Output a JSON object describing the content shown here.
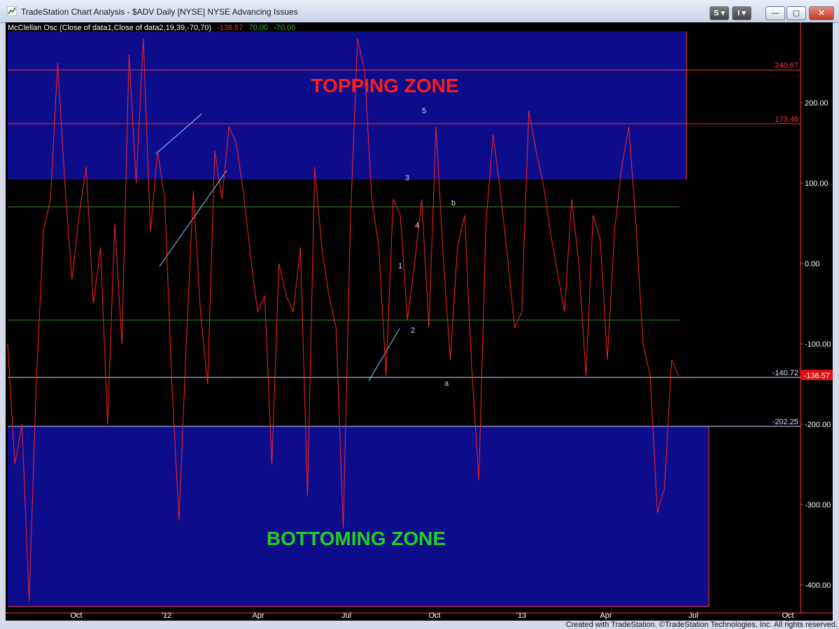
{
  "window": {
    "title": "TradeStation Chart Analysis - $ADV Daily [NYSE] NYSE Advancing Issues",
    "buttons": {
      "s": "S",
      "i": "I",
      "minimize": "—",
      "restore": "▢",
      "close": "✕"
    }
  },
  "indicator": {
    "label": "McClellan Osc (Close of data1,Close of data2,19,39,-70,70)",
    "value": "-136.57",
    "upper": "70.00",
    "lower": "-70.00"
  },
  "zones": {
    "topping_label": "TOPPING ZONE",
    "bottoming_label": "BOTTOMING ZONE"
  },
  "levels": {
    "l1": "240.67",
    "l2": "173.46",
    "l3": "-140.72",
    "l4": "-202.25",
    "current_badge": "-136.57"
  },
  "wave_labels": [
    "5",
    "3",
    "b",
    "4",
    "1",
    "2",
    "a"
  ],
  "footer": "Created with TradeStation. ©TradeStation Technologies, Inc. All rights reserved.",
  "colors": {
    "background": "#000000",
    "zone": "#0d0d8c",
    "oscillator": "#ff2222",
    "topping_text": "#ff1a1a",
    "bottoming_text": "#22d022",
    "guide_green": "#2f8f2f",
    "trend_lines": "#7fd4ff"
  },
  "chart_data": {
    "type": "line",
    "title": "",
    "xlabel": "",
    "ylabel": "",
    "ylim": [
      -420,
      290
    ],
    "y_ticks": [
      "200.00",
      "100.00",
      "0.00",
      "-100.00",
      "-200.00",
      "-300.00",
      "-400.00"
    ],
    "x_ticks": [
      "Oct",
      "'12",
      "Apr",
      "Jul",
      "Oct",
      "'13",
      "Apr",
      "Jul",
      "Oct"
    ],
    "reference_lines": [
      240.67,
      173.46,
      70,
      -70,
      -140.72,
      -202.25
    ],
    "zones": [
      {
        "name": "TOPPING ZONE",
        "from": 104,
        "to": 288
      },
      {
        "name": "BOTTOMING ZONE",
        "from": -202.25,
        "to": -425
      }
    ],
    "series": [
      {
        "values": [
          -100,
          -250,
          -200,
          -420,
          -150,
          40,
          80,
          250,
          100,
          -20,
          60,
          120,
          -50,
          20,
          -200,
          50,
          -100,
          260,
          100,
          280,
          40,
          140,
          80,
          -150,
          -320,
          -100,
          90,
          -60,
          -150,
          140,
          80,
          170,
          150,
          90,
          10,
          -60,
          -40,
          -250,
          0,
          -40,
          -60,
          20,
          -290,
          120,
          20,
          -40,
          -80,
          -330,
          50,
          280,
          240,
          80,
          20,
          -140,
          80,
          60,
          -70,
          0,
          80,
          -80,
          170,
          10,
          -120,
          20,
          60,
          -130,
          -270,
          50,
          160,
          90,
          10,
          -80,
          -60,
          190,
          140,
          100,
          40,
          -10,
          -60,
          80,
          0,
          -140,
          60,
          30,
          -120,
          40,
          120,
          170,
          50,
          -100,
          -140,
          -310,
          -280,
          -120,
          -140
        ],
        "color": "#ff2222"
      }
    ]
  }
}
